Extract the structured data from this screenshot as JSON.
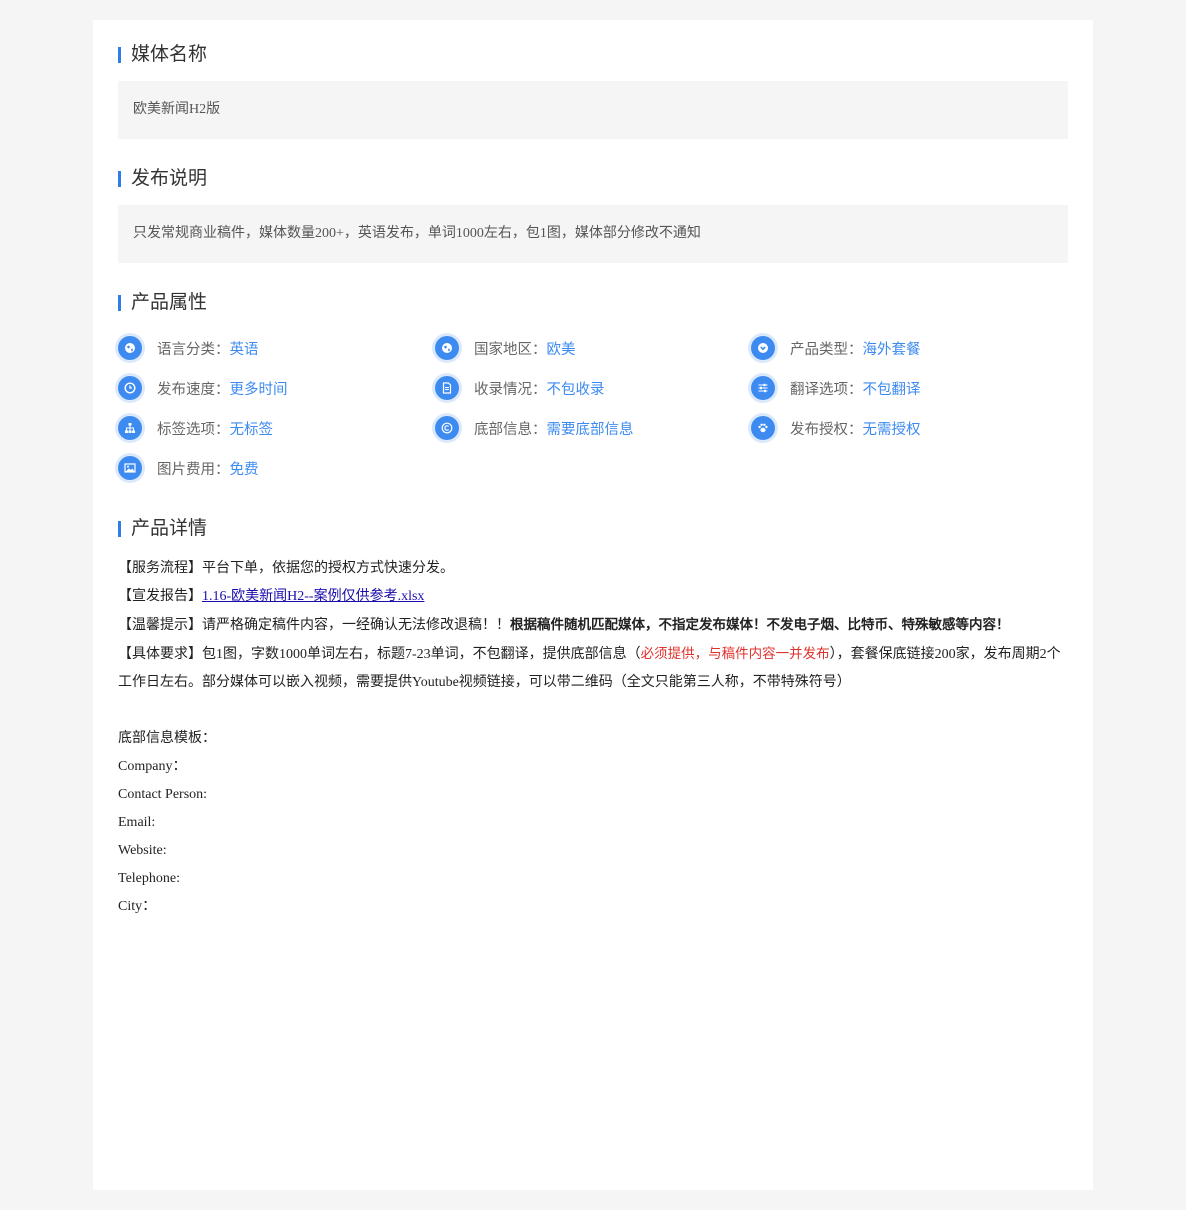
{
  "sections": {
    "media_name": {
      "title": "媒体名称",
      "value": "欧美新闻H2版"
    },
    "publish_note": {
      "title": "发布说明",
      "value": "只发常规商业稿件，媒体数量200+，英语发布，单词1000左右，包1图，媒体部分修改不通知"
    },
    "attributes": {
      "title": "产品属性",
      "items": [
        {
          "icon": "globe-icon",
          "label": "语言分类：",
          "value": "英语"
        },
        {
          "icon": "globe-icon",
          "label": "国家地区：",
          "value": "欧美"
        },
        {
          "icon": "chevron-down-icon",
          "label": "产品类型：",
          "value": "海外套餐"
        },
        {
          "icon": "clock-icon",
          "label": "发布速度：",
          "value": "更多时间"
        },
        {
          "icon": "document-icon",
          "label": "收录情况：",
          "value": "不包收录"
        },
        {
          "icon": "sliders-icon",
          "label": "翻译选项：",
          "value": "不包翻译"
        },
        {
          "icon": "sitemap-icon",
          "label": "标签选项：",
          "value": "无标签"
        },
        {
          "icon": "copyright-icon",
          "label": "底部信息：",
          "value": "需要底部信息"
        },
        {
          "icon": "paw-icon",
          "label": "发布授权：",
          "value": "无需授权"
        },
        {
          "icon": "image-icon",
          "label": "图片费用：",
          "value": "免费"
        }
      ]
    },
    "details": {
      "title": "产品详情",
      "service_flow_label": "【服务流程】",
      "service_flow_text": "平台下单，依据您的授权方式快速分发。",
      "report_label": "【宣发报告】",
      "report_link": "1.16-欧美新闻H2--案例仅供参考.xlsx",
      "tip_label": "【温馨提示】",
      "tip_text": "请严格确定稿件内容，一经确认无法修改退稿！！",
      "tip_bold": "根据稿件随机匹配媒体，不指定发布媒体！不发电子烟、比特币、特殊敏感等内容！",
      "req_label": "【具体要求】",
      "req_text_1": "包1图，字数1000单词左右，标题7-23单词，不包翻译，提供底部信息（",
      "req_red": "必须提供，与稿件内容一并发布",
      "req_text_2": "），套餐保底链接200家，发布周期2个工作日左右。部分媒体可以嵌入视频，需要提供Youtube视频链接，可以带二维码（全文只能第三人称，不带特殊符号）",
      "template_title": "底部信息模板：",
      "template_fields": [
        "Company：",
        "Contact Person:",
        "Email:",
        "Website:",
        "Telephone:",
        "City："
      ]
    }
  },
  "colors": {
    "accent": "#3d8bf0",
    "bar": "#2f7ee6",
    "warning_red": "#e0322c",
    "link": "#1a0dab"
  }
}
